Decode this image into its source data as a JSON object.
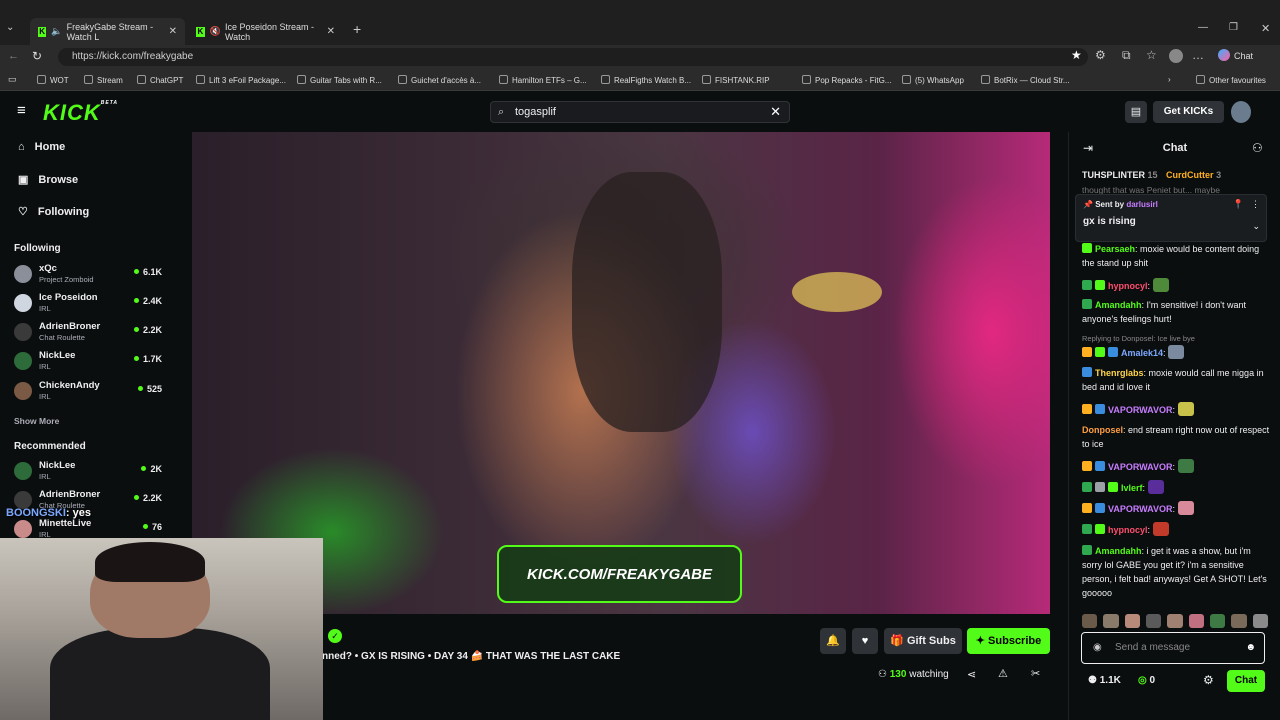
{
  "browser": {
    "tabs": [
      {
        "label": "FreakyGabe Stream - Watch L"
      },
      {
        "label": "Ice Poseidon Stream - Watch"
      }
    ],
    "url": "https://kick.com/freakygabe",
    "profile_label": "Chat",
    "bookmarks": [
      "WOT",
      "Stream",
      "ChatGPT",
      "Lift 3 eFoil Package...",
      "Guitar Tabs with R...",
      "Guichet d'accès à...",
      "Hamilton ETFs – G...",
      "RealFigths Watch B...",
      "FISHTANK.RIP",
      "Pop Repacks - FitG...",
      "(5) WhatsApp",
      "BotRix — Cloud Str...",
      "Other favourites"
    ]
  },
  "header": {
    "logo": "KICK",
    "logo_beta": "BETA",
    "search_value": "togasplif",
    "get_kicks": "Get KICKs"
  },
  "sidebar": {
    "nav": [
      {
        "label": "Home"
      },
      {
        "label": "Browse"
      },
      {
        "label": "Following"
      }
    ],
    "following_title": "Following",
    "following": [
      {
        "name": "xQc",
        "category": "Project Zomboid",
        "viewers": "6.1K"
      },
      {
        "name": "Ice Poseidon",
        "category": "IRL",
        "viewers": "2.4K"
      },
      {
        "name": "AdrienBroner",
        "category": "Chat Roulette",
        "viewers": "2.2K"
      },
      {
        "name": "NickLee",
        "category": "IRL",
        "viewers": "1.7K"
      },
      {
        "name": "ChickenAndy",
        "category": "IRL",
        "viewers": "525"
      }
    ],
    "show_more": "Show More",
    "recommended_title": "Recommended",
    "recommended": [
      {
        "name": "NickLee",
        "category": "IRL",
        "viewers": "2K"
      },
      {
        "name": "AdrienBroner",
        "category": "Chat Roulette",
        "viewers": "2.2K"
      },
      {
        "name": "MinetteLive",
        "category": "IRL",
        "viewers": "76"
      }
    ]
  },
  "video": {
    "watermark": "KICK.COM/FREAKYGABE"
  },
  "overlay": {
    "user": "BOONGSKI",
    "text": ": yes"
  },
  "stream": {
    "title": "nned? • GX IS RISING • DAY 34 🍰 THAT WAS THE LAST CAKE",
    "gift_subs": "Gift Subs",
    "subscribe": "Subscribe",
    "viewers": "130",
    "watching_label": "watching"
  },
  "chat": {
    "title": "Chat",
    "top_user_1": "TUHSPLINTER",
    "top_count_1": "15",
    "top_user_2": "CurdCutter",
    "top_count_2": "3",
    "top_partial": "thought that was Peniet but... maybe",
    "pinned_by_label": "Sent by",
    "pinned_by": "darlusirl",
    "pinned_text": "gx is rising",
    "messages": [
      {
        "user": "Pearsaeh",
        "color": "#53fc18",
        "text": ": moxie would be content doing the stand up shit"
      },
      {
        "user": "hypnocyl",
        "color": "#ff4d6d",
        "text": ":"
      },
      {
        "user": "Amandahh",
        "color": "#53fc18",
        "text": ": I'm sensitive! i don't want anyone's feelings hurt!"
      },
      {
        "user": "Amalek14",
        "color": "#7ca8ff",
        "text": ":"
      },
      {
        "user": "Thenrglabs",
        "color": "#ffd54a",
        "text": ": moxie would call me nigga in bed and id love it"
      },
      {
        "user": "VAPORWAVOR",
        "color": "#c77dff",
        "text": ":"
      },
      {
        "user": "Donposel",
        "color": "#ff9f43",
        "text": ": end stream right now out of respect to ice"
      },
      {
        "user": "VAPORWAVOR",
        "color": "#c77dff",
        "text": ":"
      },
      {
        "user": "Ivlerf",
        "color": "#53fc18",
        "text": ":"
      },
      {
        "user": "VAPORWAVOR",
        "color": "#c77dff",
        "text": ":"
      },
      {
        "user": "hypnocyl",
        "color": "#ff4d6d",
        "text": ":"
      },
      {
        "user": "Amandahh",
        "color": "#53fc18",
        "text": ": i get it was a show, but i'm sorry lol GABE you get it? i'm a sensitive person, i felt bad! anyways! Get A SHOT! Let's gooooo"
      }
    ],
    "reply_label": "Replying to Donposel: Ice live bye",
    "input_placeholder": "Send a message",
    "followers": "1.1K",
    "kicks": "0",
    "send_label": "Chat"
  }
}
